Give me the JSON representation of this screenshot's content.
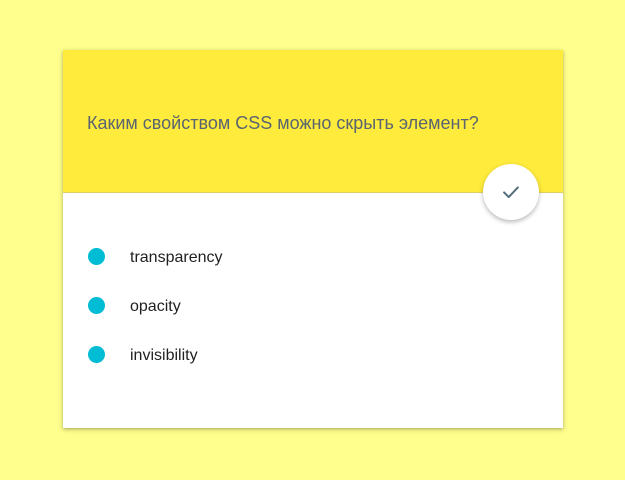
{
  "quiz": {
    "question": "Каким свойством CSS можно скрыть элемент?",
    "submit_icon": "check-icon",
    "options": [
      {
        "label": "transparency"
      },
      {
        "label": "opacity"
      },
      {
        "label": "invisibility"
      }
    ]
  },
  "colors": {
    "page_background": "#ffff8d",
    "header_background": "#ffeb3b",
    "option_marker": "#00bcd4",
    "question_text": "#5a6470",
    "check_icon": "#546e7a"
  }
}
